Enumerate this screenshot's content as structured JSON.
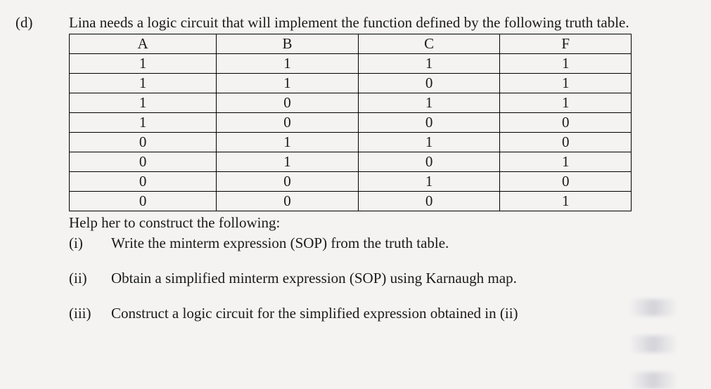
{
  "label": "(d)",
  "intro": "Lina needs a logic circuit that will implement the function defined by the following truth table.",
  "table": {
    "headers": [
      "A",
      "B",
      "C",
      "F"
    ],
    "rows": [
      [
        "1",
        "1",
        "1",
        "1"
      ],
      [
        "1",
        "1",
        "0",
        "1"
      ],
      [
        "1",
        "0",
        "1",
        "1"
      ],
      [
        "1",
        "0",
        "0",
        "0"
      ],
      [
        "0",
        "1",
        "1",
        "0"
      ],
      [
        "0",
        "1",
        "0",
        "1"
      ],
      [
        "0",
        "0",
        "1",
        "0"
      ],
      [
        "0",
        "0",
        "0",
        "1"
      ]
    ]
  },
  "help_line": "Help her to construct the following:",
  "parts": [
    {
      "label": "(i)",
      "text": "Write the minterm expression (SOP) from the truth table."
    },
    {
      "label": "(ii)",
      "text": "Obtain a simplified minterm expression (SOP) using Karnaugh map."
    },
    {
      "label": "(iii)",
      "text": "Construct a logic circuit for the simplified expression obtained in (ii)"
    }
  ]
}
